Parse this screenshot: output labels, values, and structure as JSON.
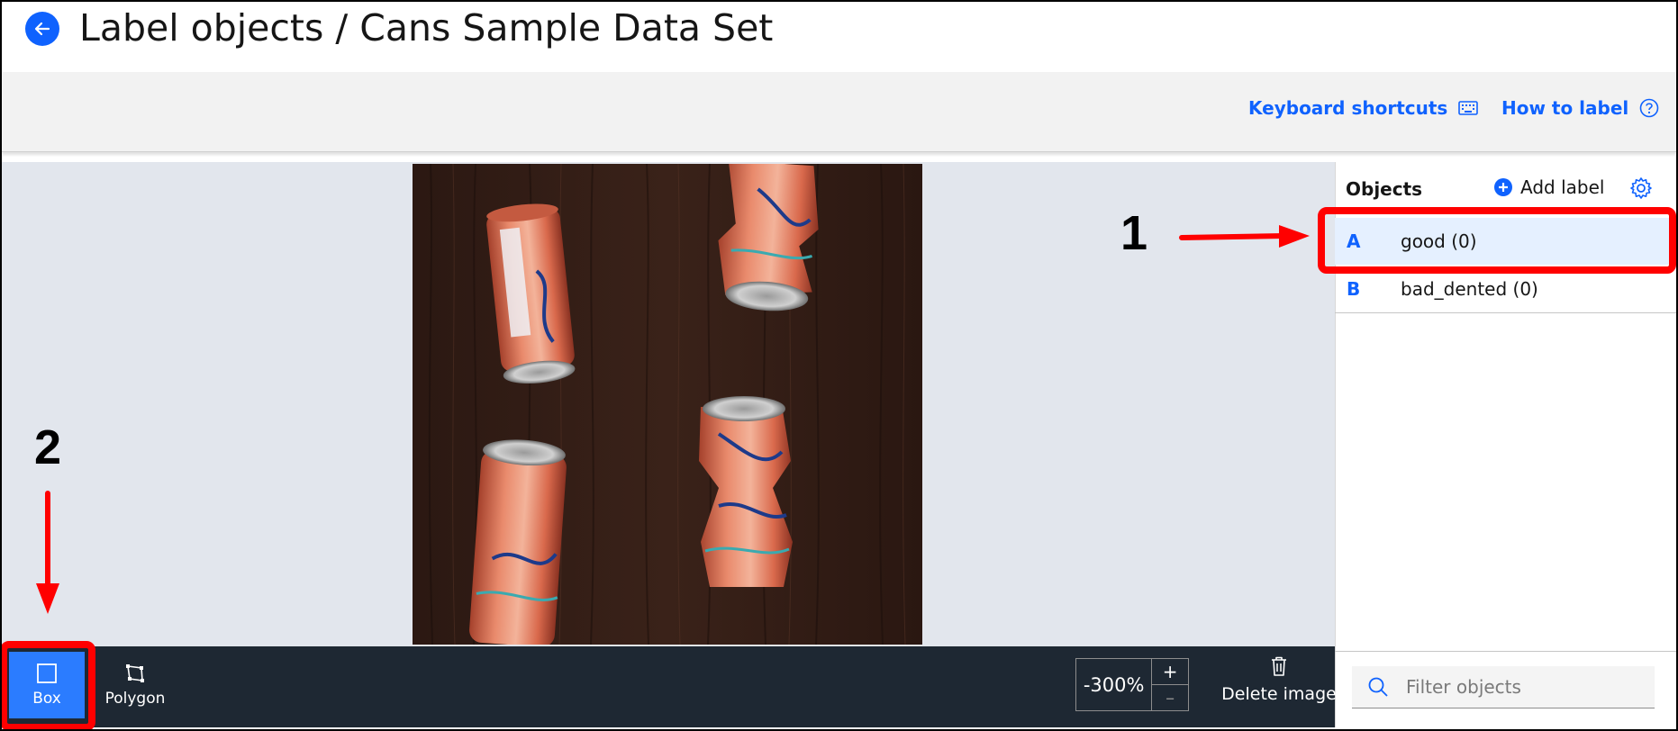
{
  "header": {
    "title": "Label objects / Cans Sample Data Set",
    "back_icon": "arrow-left-icon"
  },
  "toolbar": {
    "keyboard_shortcuts_label": "Keyboard shortcuts",
    "how_to_label": "How to label"
  },
  "objects_panel": {
    "title": "Objects",
    "add_label": "Add label",
    "items": [
      {
        "key": "A",
        "name": "good (0)",
        "selected": true
      },
      {
        "key": "B",
        "name": "bad_dented (0)",
        "selected": false
      }
    ],
    "filter_placeholder": "Filter objects"
  },
  "tools": {
    "box_label": "Box",
    "polygon_label": "Polygon",
    "zoom_value": "-300%",
    "zoom_in": "+",
    "zoom_out": "–",
    "delete_label": "Delete image"
  },
  "annotations": {
    "callout_1": "1",
    "callout_2": "2"
  },
  "colors": {
    "accent": "#0f62fe",
    "annotation_red": "#ff0000",
    "toolbar_dark": "#1e2833",
    "selected_row": "#e5f0ff"
  }
}
